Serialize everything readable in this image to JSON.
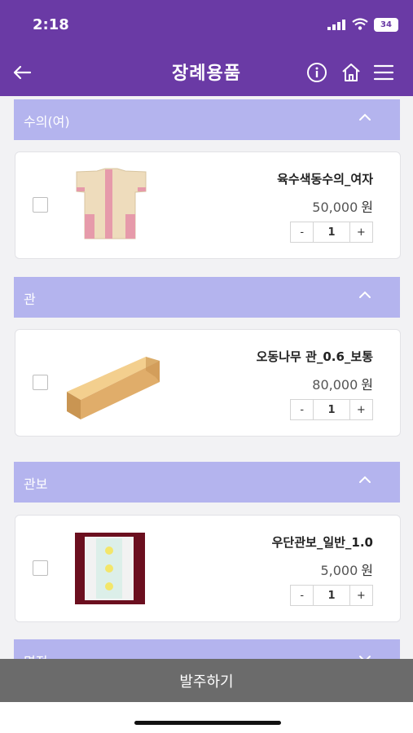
{
  "status": {
    "time": "2:18",
    "battery": "34"
  },
  "header": {
    "title": "장례용품"
  },
  "sections": [
    {
      "title": "수의(여)",
      "product": {
        "name": "육수색동수의_여자",
        "price": "50,000",
        "unit": "원",
        "qty": "1"
      }
    },
    {
      "title": "관",
      "product": {
        "name": "오동나무 관_0.6_보통",
        "price": "80,000",
        "unit": "원",
        "qty": "1"
      }
    },
    {
      "title": "관보",
      "product": {
        "name": "우단관보_일반_1.0",
        "price": "5,000",
        "unit": "원",
        "qty": "1"
      }
    },
    {
      "title": "명정"
    }
  ],
  "stepper": {
    "minus": "-",
    "plus": "+"
  },
  "order_button": "발주하기",
  "colors": {
    "primary": "#6a3aa5",
    "section": "#b4b4ee",
    "order_bar": "#6b6b6b"
  }
}
